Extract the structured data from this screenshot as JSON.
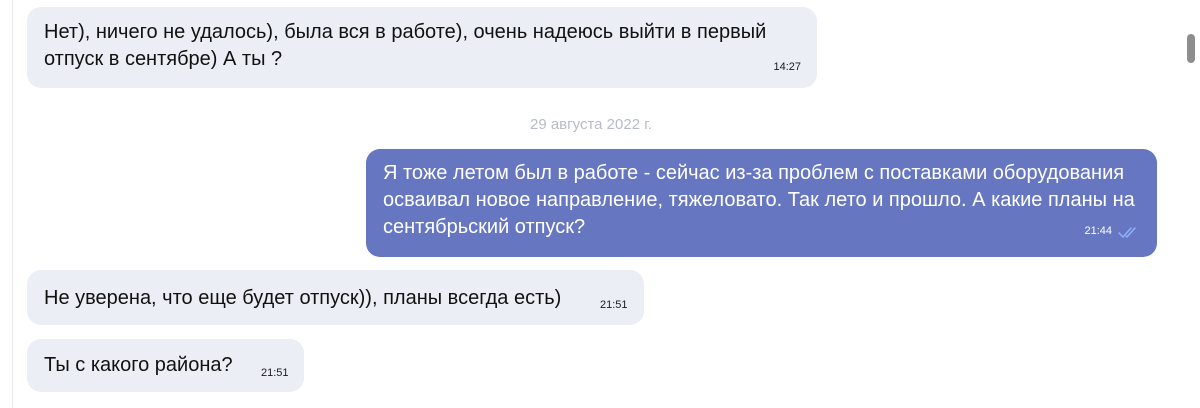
{
  "messages": [
    {
      "direction": "incoming",
      "text": "Нет), ничего не удалось), была вся в работе), очень надеюсь выйти в первый отпуск в сентябре) А ты ?",
      "time": "14:27"
    },
    {
      "direction": "outgoing",
      "text": "Я тоже летом был в работе - сейчас из-за проблем с поставками оборудования осваивал новое направление, тяжеловато. Так лето и прошло. А какие планы на сентябрьский отпуск?",
      "time": "21:44",
      "status": "read"
    },
    {
      "direction": "incoming",
      "text": "Не уверена, что еще будет отпуск)), планы всегда есть)",
      "time": "21:51"
    },
    {
      "direction": "incoming",
      "text": "Ты с какого района?",
      "time": "21:51"
    }
  ],
  "date_separator": "29 августа 2022 г.",
  "colors": {
    "incoming_bubble": "#ebeef5",
    "outgoing_bubble": "#6676c1",
    "date_text": "#b8bcc6",
    "read_ticks": "#8fb0ff"
  },
  "icons": {
    "read_status": "double-check-icon"
  }
}
